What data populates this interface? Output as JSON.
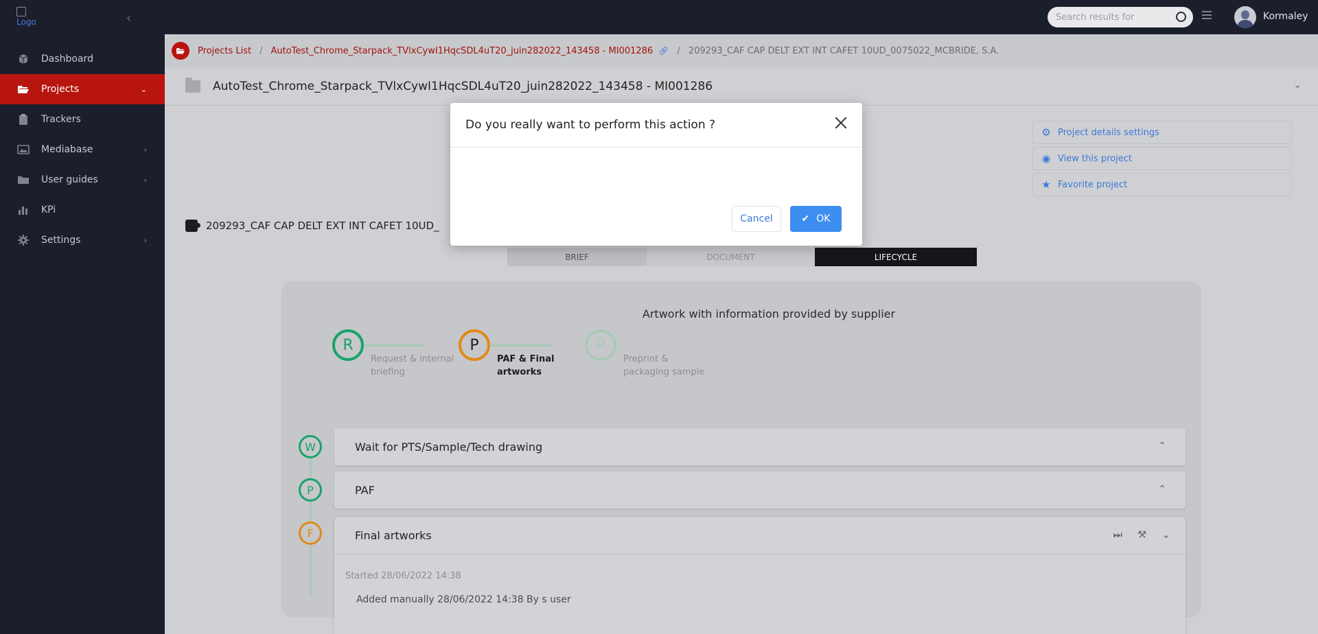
{
  "logo": {
    "alt_text": "Logo"
  },
  "sidebar": {
    "collapse_glyph": "‹",
    "items": [
      {
        "label": "Dashboard",
        "icon": "cube-icon",
        "active": false
      },
      {
        "label": "Projects",
        "icon": "folder-open-icon",
        "active": true
      },
      {
        "label": "Trackers",
        "icon": "clipboard-icon",
        "active": false
      },
      {
        "label": "Mediabase",
        "icon": "image-icon",
        "active": false
      },
      {
        "label": "User guides",
        "icon": "folder-icon",
        "active": false
      },
      {
        "label": "KPi",
        "icon": "bar-chart-icon",
        "active": false
      },
      {
        "label": "Settings",
        "icon": "gear-icon",
        "active": false
      }
    ]
  },
  "topbar": {
    "search_placeholder": "Search results for",
    "username": "Kormaley"
  },
  "breadcrumb": {
    "root": "Projects List",
    "project": "AutoTest_Chrome_Starpack_TVlxCywI1HqcSDL4uT20_juin282022_143458 - MI001286",
    "current": "209293_CAF CAP DELT EXT INT CAFET 10UD_0075022_MCBRIDE, S.A."
  },
  "project": {
    "title": "AutoTest_Chrome_Starpack_TVlxCywI1HqcSDL4uT20_juin282022_143458 - MI001286"
  },
  "actions": {
    "settings": "Project details settings",
    "view": "View this project",
    "favorite": "Favorite project"
  },
  "document": {
    "title": "209293_CAF CAP DELT EXT INT CAFET 10UD_"
  },
  "tabs": {
    "brief": "BRIEF",
    "document": "DOCUMENT",
    "lifecycle": "LIFECYCLE"
  },
  "lifecycle": {
    "title": "Artwork with information provided by supplier",
    "steps": [
      {
        "letter": "R",
        "label_line1": "Request & internal",
        "label_line2": "briefing",
        "color": "#18a36a"
      },
      {
        "letter": "P",
        "label_line1": "PAF & Final",
        "label_line2": "artworks",
        "color": "#e08a16"
      },
      {
        "letter": "P",
        "label_line1": "Preprint &",
        "label_line2": "packaging sample",
        "color": "#a9c9b8"
      }
    ],
    "stages": [
      {
        "letter": "W",
        "name": "Wait for PTS/Sample/Tech drawing",
        "color": "#18a36a"
      },
      {
        "letter": "P",
        "name": "PAF",
        "color": "#18a36a"
      },
      {
        "letter": "F",
        "name": "Final artworks",
        "color": "#e08a16"
      }
    ],
    "final": {
      "started": "Started 28/06/2022 14:38",
      "added": "Added manually 28/06/2022 14:38 By s user"
    }
  },
  "modal": {
    "title": "Do you really want to perform this action ?",
    "cancel": "Cancel",
    "ok": "OK"
  }
}
